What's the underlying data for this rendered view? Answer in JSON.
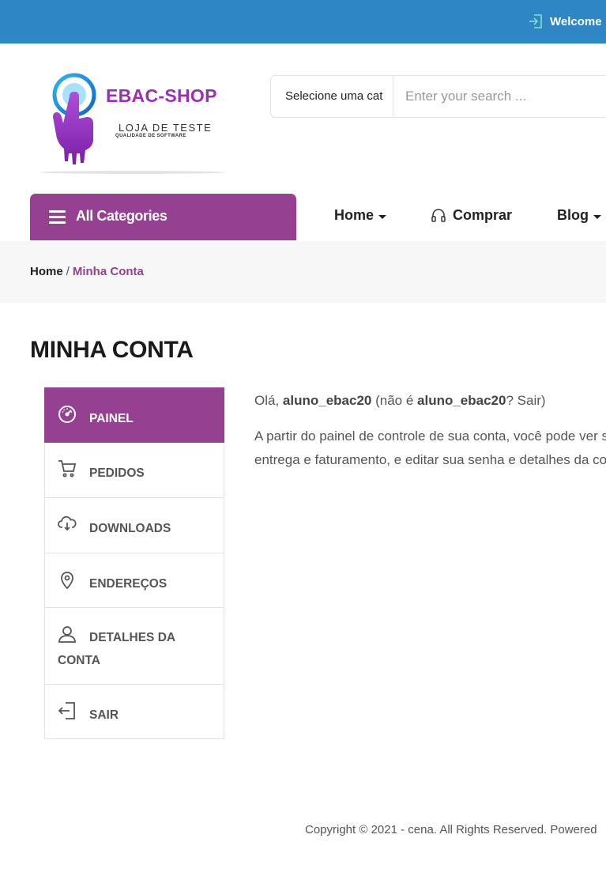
{
  "topbar": {
    "welcome": "Welcome"
  },
  "logo": {
    "brand": "EBAC-SHOP",
    "sub1": "LOJA DE TESTE",
    "sub2": "QUALIDADE DE SOFTWARE"
  },
  "search": {
    "category": "Selecione uma cat",
    "placeholder": "Enter your search ..."
  },
  "all_categories": "All Categories",
  "nav": {
    "home": "Home",
    "comprar": "Comprar",
    "blog": "Blog"
  },
  "breadcrumb": {
    "home": "Home",
    "separator": "/",
    "current": "Minha Conta"
  },
  "page_title": "MINHA CONTA",
  "account_nav": [
    {
      "label": "PAINEL",
      "icon": "dashboard-icon",
      "active": true
    },
    {
      "label": "PEDIDOS",
      "icon": "cart-icon"
    },
    {
      "label": "DOWNLOADS",
      "icon": "cloud-download-icon"
    },
    {
      "label": "ENDEREÇOS",
      "icon": "location-pin-icon"
    },
    {
      "label": "DETALHES DA CONTA",
      "icon": "user-icon"
    },
    {
      "label": "SAIR",
      "icon": "logout-icon"
    }
  ],
  "greeting": {
    "prefix": "Olá, ",
    "user": "aluno_ebac20",
    "middle": " (não é ",
    "user2": "aluno_ebac20",
    "suffix": "? ",
    "logout": "Sair",
    "close": ")"
  },
  "intro": {
    "line1": "A partir do painel de controle de sua conta, você pode ver su",
    "line2": "entrega e faturamento, e editar sua senha e detalhes da con"
  },
  "footer": {
    "copyright": "Copyright © 2021 - cena. All Rights Reserved. Powered"
  },
  "colors": {
    "topbar": "#2e86c5",
    "accent": "#954091",
    "brand": "#9a2fb8"
  }
}
